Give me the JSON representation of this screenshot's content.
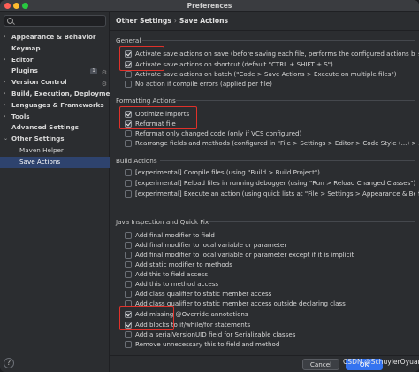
{
  "window": {
    "title": "Preferences"
  },
  "search": {
    "placeholder": "",
    "value": ""
  },
  "sidebar": {
    "items": [
      {
        "label": "Appearance & Behavior",
        "chevron": "›",
        "level": 0
      },
      {
        "label": "Keymap",
        "chevron": "",
        "level": 0
      },
      {
        "label": "Editor",
        "chevron": "›",
        "level": 0
      },
      {
        "label": "Plugins",
        "chevron": "",
        "level": 0,
        "badge": "1"
      },
      {
        "label": "Version Control",
        "chevron": "›",
        "level": 0
      },
      {
        "label": "Build, Execution, Deployment",
        "chevron": "›",
        "level": 0
      },
      {
        "label": "Languages & Frameworks",
        "chevron": "›",
        "level": 0
      },
      {
        "label": "Tools",
        "chevron": "›",
        "level": 0
      },
      {
        "label": "Advanced Settings",
        "chevron": "",
        "level": 0
      },
      {
        "label": "Other Settings",
        "chevron": "⌄",
        "level": 0
      },
      {
        "label": "Maven Helper",
        "chevron": "",
        "level": 1
      },
      {
        "label": "Save Actions",
        "chevron": "",
        "level": 1,
        "selected": true
      }
    ],
    "help": "?"
  },
  "breadcrumb": {
    "parent": "Other Settings",
    "separator": "›",
    "current": "Save Actions"
  },
  "sections": {
    "general": {
      "title": "General",
      "items": [
        {
          "label": "Activate save actions on save (before saving each file, performs the configured actions below)",
          "checked": true
        },
        {
          "label": "Activate save actions on shortcut (default \"CTRL + SHIFT + S\")",
          "checked": true
        },
        {
          "label": "Activate save actions on batch (\"Code > Save Actions > Execute on multiple files\")",
          "checked": false
        },
        {
          "label": "No action if compile errors (applied per file)",
          "checked": false
        }
      ]
    },
    "formatting": {
      "title": "Formatting Actions",
      "items": [
        {
          "label": "Optimize imports",
          "checked": true
        },
        {
          "label": "Reformat file",
          "checked": true
        },
        {
          "label": "Reformat only changed code (only if VCS configured)",
          "checked": false
        },
        {
          "label": "Rearrange fields and methods (configured in \"File > Settings > Editor > Code Style (...) > Arrangement\")",
          "checked": false
        }
      ]
    },
    "build": {
      "title": "Build Actions",
      "items": [
        {
          "label": "[experimental] Compile files (using \"Build > Build Project\")",
          "checked": false
        },
        {
          "label": "[experimental] Reload files in running debugger (using \"Run > Reload Changed Classes\")",
          "checked": false
        },
        {
          "label": "[experimental] Execute an action (using quick lists at \"File > Settings > Appearance & Behavior > Quick Lists\")",
          "checked": false
        }
      ]
    },
    "java": {
      "title": "Java Inspection and Quick Fix",
      "items": [
        {
          "label": "Add final modifier to field",
          "checked": false
        },
        {
          "label": "Add final modifier to local variable or parameter",
          "checked": false
        },
        {
          "label": "Add final modifier to local variable or parameter except if it is implicit",
          "checked": false
        },
        {
          "label": "Add static modifier to methods",
          "checked": false
        },
        {
          "label": "Add this to field access",
          "checked": false
        },
        {
          "label": "Add this to method access",
          "checked": false
        },
        {
          "label": "Add class qualifier to static member access",
          "checked": false
        },
        {
          "label": "Add class qualifier to static member access outside declaring class",
          "checked": false
        },
        {
          "label": "Add missing @Override annotations",
          "checked": true
        },
        {
          "label": "Add blocks to if/while/for statements",
          "checked": true
        },
        {
          "label": "Add a serialVersionUID field for Serializable classes",
          "checked": false
        },
        {
          "label": "Remove unnecessary this to field and method",
          "checked": false
        }
      ]
    }
  },
  "footer": {
    "cancel_label": "Cancel",
    "ok_label": "OK",
    "watermark": "CSDN @SchuylerOyuan"
  },
  "colors": {
    "highlight": "#e0312a",
    "selected_bg": "#2e436e",
    "primary": "#3574f0"
  }
}
